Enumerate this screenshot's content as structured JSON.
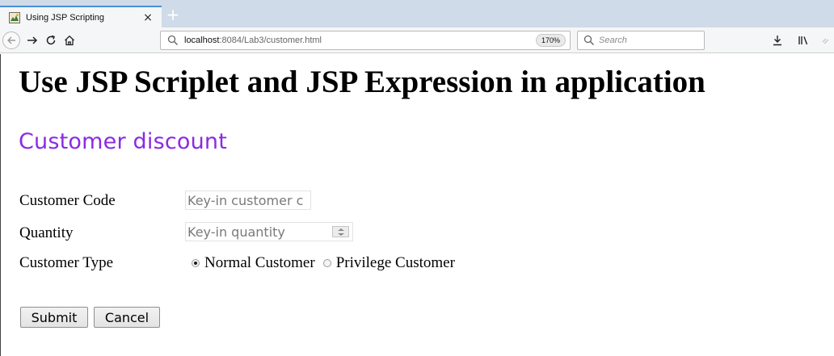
{
  "browser": {
    "tab_title": "Using JSP Scripting",
    "tab_close": "×",
    "new_tab": "+",
    "url_host": "localhost",
    "url_rest": ":8084/Lab3/customer.html",
    "zoom": "170%",
    "search_placeholder": "Search"
  },
  "page": {
    "heading": "Use JSP Scriplet and JSP Expression in application",
    "subheading": "Customer discount",
    "form": {
      "code_label": "Customer Code",
      "code_placeholder": "Key-in customer c",
      "qty_label": "Quantity",
      "qty_placeholder": "Key-in quantity",
      "type_label": "Customer Type",
      "type_options": [
        {
          "label": "Normal Customer",
          "checked": true
        },
        {
          "label": "Privilege Customer",
          "checked": false
        }
      ],
      "submit_label": "Submit",
      "cancel_label": "Cancel"
    }
  },
  "colors": {
    "subheading": "#8a2be2",
    "tab_accent": "#4a90d9"
  }
}
